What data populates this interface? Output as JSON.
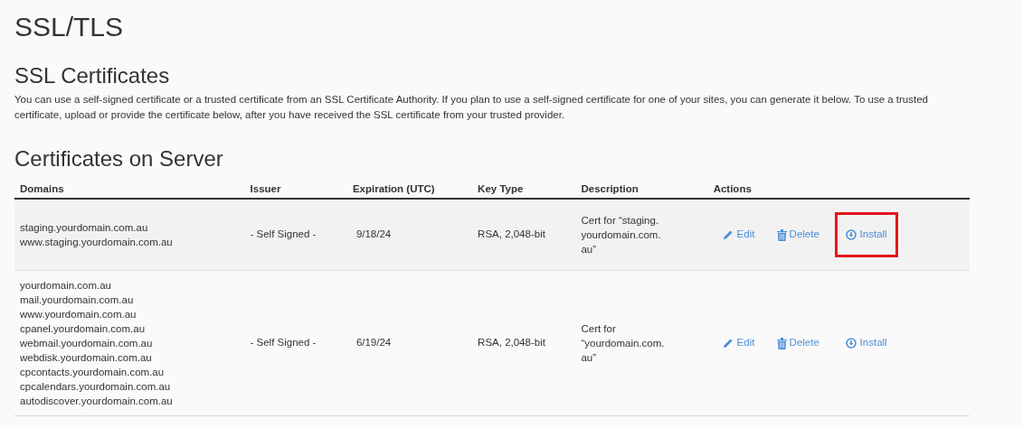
{
  "page_title": "SSL/TLS",
  "section": {
    "title": "SSL Certificates",
    "description": "You can use a self-signed certificate or a trusted certificate from an SSL Certificate Authority. If you plan to use a self-signed certificate for one of your sites, you can generate it below. To use a trusted certificate, upload or provide the certificate below, after you have received the SSL certificate from your trusted provider."
  },
  "table": {
    "title": "Certificates on Server",
    "columns": [
      "Domains",
      "Issuer",
      "Expiration (UTC)",
      "Key Type",
      "Description",
      "Actions"
    ],
    "rows": [
      {
        "shaded": true,
        "domains": [
          "staging.yourdomain.com.au",
          "www.staging.yourdomain.com.au"
        ],
        "issuer": "- Self Signed -",
        "expiration": "9/18/24",
        "key_type": "RSA, 2,048-bit",
        "description": [
          "Cert for “staging.",
          "yourdomain.com.",
          "au”"
        ],
        "actions": {
          "edit": "Edit",
          "delete": "Delete",
          "install": "Install",
          "install_highlighted": true
        }
      },
      {
        "shaded": false,
        "domains": [
          "yourdomain.com.au",
          "mail.yourdomain.com.au",
          "www.yourdomain.com.au",
          "cpanel.yourdomain.com.au",
          "webmail.yourdomain.com.au",
          "webdisk.yourdomain.com.au",
          "cpcontacts.yourdomain.com.au",
          "cpcalendars.yourdomain.com.au",
          "autodiscover.yourdomain.com.au"
        ],
        "issuer": "- Self Signed -",
        "expiration": "6/19/24",
        "key_type": "RSA, 2,048-bit",
        "description": [
          "Cert for",
          "“yourdomain.com.",
          "au”"
        ],
        "actions": {
          "edit": "Edit",
          "delete": "Delete",
          "install": "Install",
          "install_highlighted": false
        }
      }
    ]
  }
}
